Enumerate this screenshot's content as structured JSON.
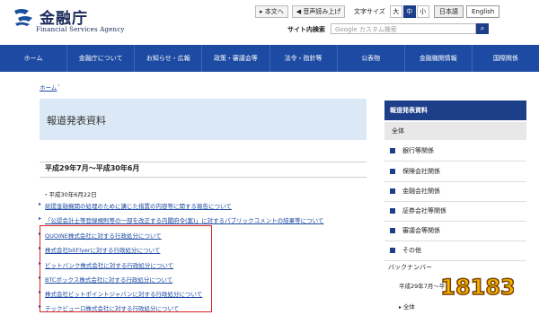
{
  "header": {
    "logo_jp": "金融庁",
    "logo_en": "Financial Services Agency",
    "skip_label": "本文へ",
    "read_aloud_label": "音声読み上げ",
    "text_size_label": "文字サイズ",
    "text_sizes": [
      "大",
      "中",
      "小"
    ],
    "lang_jp": "日本語",
    "lang_en": "English",
    "search_label": "サイト内検索",
    "search_placeholder": "Google カスタム検索"
  },
  "nav": [
    "ホーム",
    "金融庁について",
    "お知らせ・広報",
    "政策・審議会等",
    "法令・指針等",
    "公表物",
    "金融機関情報",
    "国際関係"
  ],
  "breadcrumb": "ホーム",
  "page_title": "報道発表資料",
  "section_title": "平成29年7月～平成30年6月",
  "date": "平成30年6月22日",
  "links": [
    "総提金融機関の処理のために講じた措置の内容等に関する報告について",
    "「公認会計士等登録規則等の一部を改正する内閣府令(案)」に対するパブリックコメントの結果等について",
    "QUOINE株式会社に対する行政処分について",
    "株式会社bitFlyerに対する行政処分について",
    "ビットバンク株式会社に対する行政処分について",
    "BTCボックス株式会社に対する行政処分について",
    "株式会社ビットポイントジャパンに対する行政処分について",
    "テックビューロ株式会社に対する行政処分について"
  ],
  "sidebar": {
    "heading": "報道発表資料",
    "all": "全体",
    "items": [
      "銀行等関係",
      "保険会社関係",
      "金融会社関係",
      "証券会社等関係",
      "審議会等関係",
      "その他"
    ],
    "back_label": "バックナンバー",
    "back_range": "平成29年7月～平",
    "back_all": "全体"
  },
  "badge_text": "18183",
  "colors": {
    "nav": "#1d4ba3",
    "highlight": "#dd2222",
    "title_bg": "#dbe8f6"
  }
}
